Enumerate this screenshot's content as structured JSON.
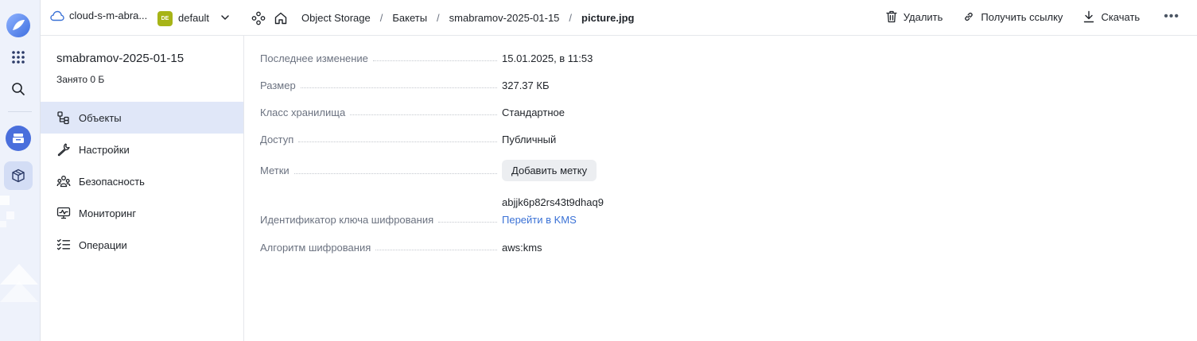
{
  "header": {
    "cloud_name": "cloud-s-m-abra...",
    "folder_badge": "DE",
    "folder_name": "default",
    "breadcrumbs": [
      {
        "label": "Object Storage"
      },
      {
        "label": "Бакеты"
      },
      {
        "label": "smabramov-2025-01-15"
      },
      {
        "label": "picture.jpg"
      }
    ],
    "actions": {
      "delete": "Удалить",
      "get_link": "Получить ссылку",
      "download": "Скачать",
      "more": "•••"
    }
  },
  "sidebar": {
    "bucket_name": "smabramov-2025-01-15",
    "usage": "Занято 0 Б",
    "items": [
      {
        "label": "Объекты",
        "icon": "objects-icon",
        "active": true
      },
      {
        "label": "Настройки",
        "icon": "wrench-icon"
      },
      {
        "label": "Безопасность",
        "icon": "users-icon"
      },
      {
        "label": "Мониторинг",
        "icon": "monitor-icon"
      },
      {
        "label": "Операции",
        "icon": "list-check-icon"
      }
    ]
  },
  "properties": {
    "last_modified": {
      "label": "Последнее изменение",
      "value": "15.01.2025, в 11:53"
    },
    "size": {
      "label": "Размер",
      "value": "327.37 КБ"
    },
    "storage_class": {
      "label": "Класс хранилища",
      "value": "Стандартное"
    },
    "access": {
      "label": "Доступ",
      "value": "Публичный"
    },
    "tags": {
      "label": "Метки",
      "button": "Добавить метку"
    },
    "encryption_key": {
      "label": "Идентификатор ключа шифрования",
      "value": "abjjk6p82rs43t9dhaq9",
      "link": "Перейти в KMS"
    },
    "encryption_algo": {
      "label": "Алгоритм шифрования",
      "value": "aws:kms"
    }
  },
  "colors": {
    "accent": "#3b72d6",
    "active_nav": "#e0e7f8",
    "rail_bg": "#eef2fb",
    "folder_badge": "#a7b417",
    "storage_service": "#4a6fdc"
  }
}
